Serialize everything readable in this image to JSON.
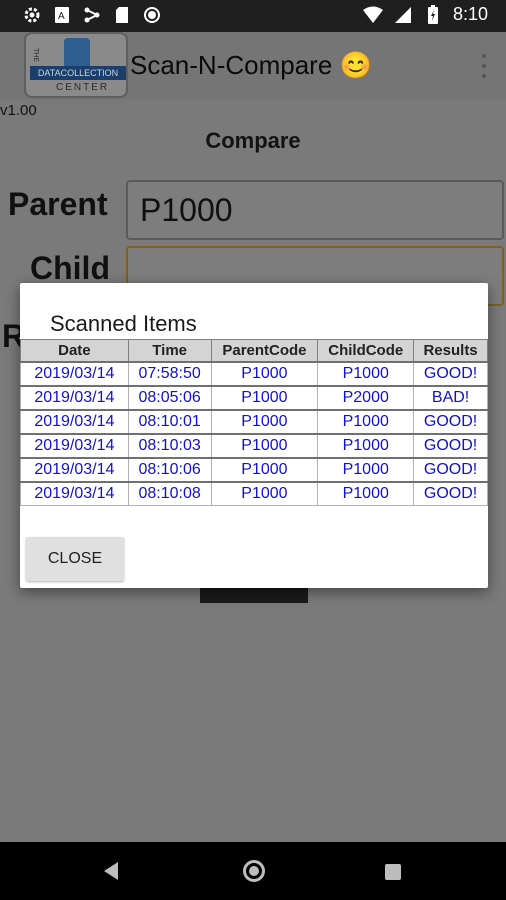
{
  "status_bar": {
    "time": "8:10",
    "left_icons": [
      "settings-icon",
      "translate-icon",
      "network-icon",
      "sd-card-icon",
      "circle-icon"
    ],
    "right_icons": [
      "wifi-icon",
      "signal-icon",
      "battery-icon"
    ]
  },
  "app_bar": {
    "logo_band_text": "DATACOLLECTION",
    "logo_bottom_text": "CENTER",
    "logo_top_text": "THE",
    "title": "Scan-N-Compare 😊"
  },
  "version": "v1.00",
  "compare_heading": "Compare",
  "form": {
    "parent_label": "Parent",
    "parent_value": "P1000",
    "child_label": "Child",
    "child_value": "",
    "r_label": "R"
  },
  "dialog": {
    "title": "Scanned Items",
    "columns": [
      "Date",
      "Time",
      "ParentCode",
      "ChildCode",
      "Results"
    ],
    "rows": [
      [
        "2019/03/14",
        "07:58:50",
        "P1000",
        "P1000",
        "GOOD!"
      ],
      [
        "2019/03/14",
        "08:05:06",
        "P1000",
        "P2000",
        "BAD!"
      ],
      [
        "2019/03/14",
        "08:10:01",
        "P1000",
        "P1000",
        "GOOD!"
      ],
      [
        "2019/03/14",
        "08:10:03",
        "P1000",
        "P1000",
        "GOOD!"
      ],
      [
        "2019/03/14",
        "08:10:06",
        "P1000",
        "P1000",
        "GOOD!"
      ],
      [
        "2019/03/14",
        "08:10:08",
        "P1000",
        "P1000",
        "GOOD!"
      ]
    ],
    "close_label": "CLOSE"
  },
  "colors": {
    "table_text": "#1010d0",
    "overlay": "#7a7a7a"
  }
}
